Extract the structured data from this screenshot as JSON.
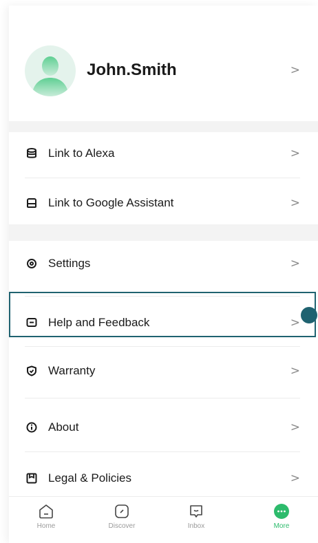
{
  "profile": {
    "name": "John.Smith"
  },
  "menu": {
    "link_alexa": "Link to Alexa",
    "link_google": "Link to Google Assistant",
    "settings": "Settings",
    "help": "Help and Feedback",
    "warranty": "Warranty",
    "about": "About",
    "legal": "Legal & Policies"
  },
  "chevron": ">",
  "tabs": [
    {
      "label": "Home",
      "icon": "home-icon"
    },
    {
      "label": "Discover",
      "icon": "compass-icon"
    },
    {
      "label": "Inbox",
      "icon": "message-icon"
    },
    {
      "label": "More",
      "icon": "more-icon"
    }
  ],
  "colors": {
    "accent": "#2dbb6c",
    "highlight": "#1f6270",
    "avatar_bg": "#e4f3ec"
  }
}
